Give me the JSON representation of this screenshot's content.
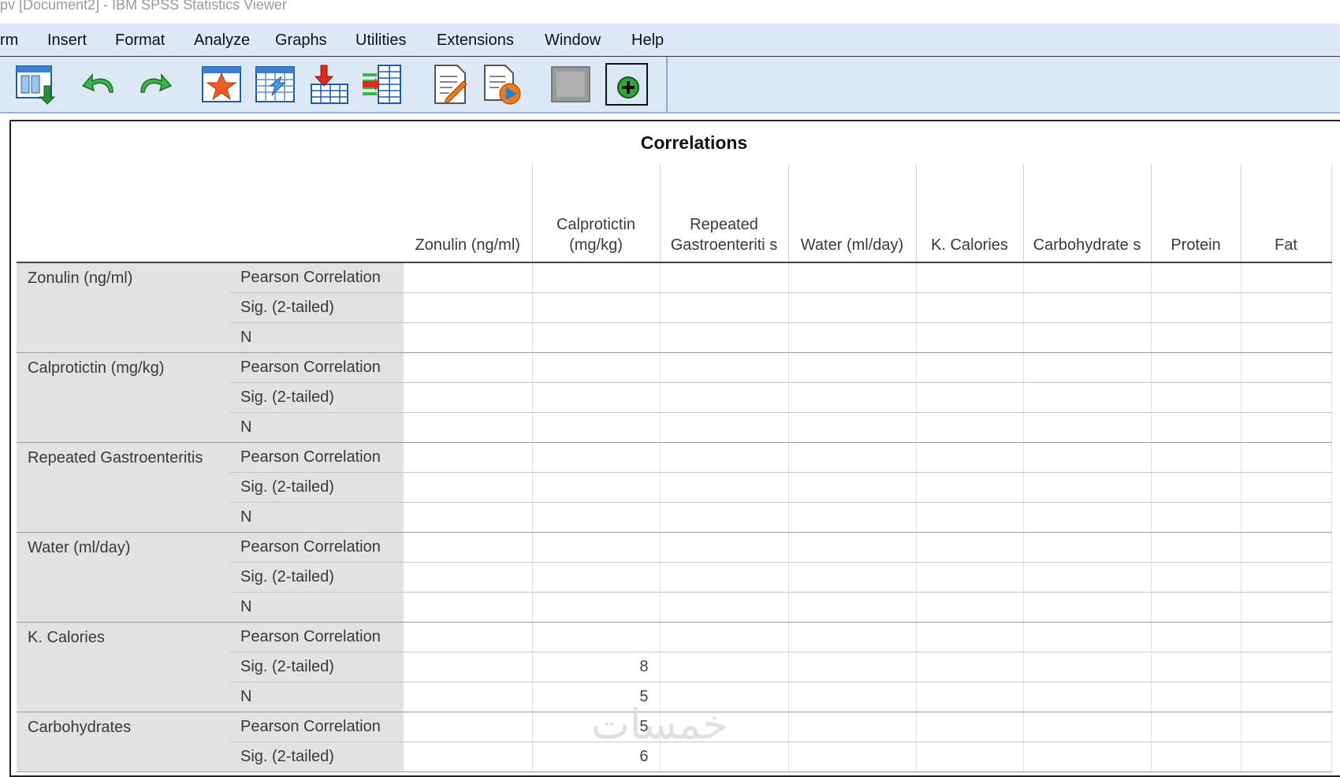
{
  "window": {
    "title": "pv [Document2] - IBM SPSS Statistics Viewer"
  },
  "menu": {
    "items": [
      {
        "label": "rm"
      },
      {
        "label": "Insert"
      },
      {
        "label": "Format"
      },
      {
        "label": "Analyze"
      },
      {
        "label": "Graphs"
      },
      {
        "label": "Utilities"
      },
      {
        "label": "Extensions"
      },
      {
        "label": "Window"
      },
      {
        "label": "Help"
      }
    ]
  },
  "toolbar": {
    "buttons": [
      {
        "icon": "export-icon"
      },
      {
        "icon": "undo-icon"
      },
      {
        "icon": "redo-icon"
      },
      {
        "icon": "goto-data-icon"
      },
      {
        "icon": "goto-case-icon"
      },
      {
        "icon": "insert-cases-icon"
      },
      {
        "icon": "insert-variable-icon"
      },
      {
        "icon": "text-output-icon"
      },
      {
        "icon": "run-script-icon"
      },
      {
        "icon": "pivot-disabled-icon"
      },
      {
        "icon": "designate-window-icon"
      }
    ]
  },
  "output": {
    "table_title": "Correlations",
    "columns": [
      "Zonulin (ng/ml)",
      "Calprotictin (mg/kg)",
      "Repeated Gastroenteriti s",
      "Water (ml/day)",
      "K. Calories",
      "Carbohydrate s",
      "Protein",
      "Fat"
    ],
    "row_groups": [
      {
        "variable": "Zonulin (ng/ml)",
        "stats": [
          "Pearson Correlation",
          "Sig. (2-tailed)",
          "N"
        ],
        "cells": [
          [
            "",
            "",
            "",
            "",
            "",
            "",
            "",
            ""
          ],
          [
            "",
            "",
            "",
            "",
            "",
            "",
            "",
            ""
          ],
          [
            "",
            "",
            "",
            "",
            "",
            "",
            "",
            ""
          ]
        ]
      },
      {
        "variable": "Calprotictin (mg/kg)",
        "stats": [
          "Pearson Correlation",
          "Sig. (2-tailed)",
          "N"
        ],
        "cells": [
          [
            "",
            "",
            "",
            "",
            "",
            "",
            "",
            ""
          ],
          [
            "",
            "",
            "",
            "",
            "",
            "",
            "",
            ""
          ],
          [
            "",
            "",
            "",
            "",
            "",
            "",
            "",
            ""
          ]
        ]
      },
      {
        "variable": "Repeated  Gastroenteritis",
        "stats": [
          "Pearson Correlation",
          "Sig. (2-tailed)",
          "N"
        ],
        "cells": [
          [
            "",
            "",
            "",
            "",
            "",
            "",
            "",
            ""
          ],
          [
            "",
            "",
            "",
            "",
            "",
            "",
            "",
            ""
          ],
          [
            "",
            "",
            "",
            "",
            "",
            "",
            "",
            ""
          ]
        ]
      },
      {
        "variable": "Water (ml/day)",
        "stats": [
          "Pearson Correlation",
          "Sig. (2-tailed)",
          "N"
        ],
        "cells": [
          [
            "",
            "",
            "",
            "",
            "",
            "",
            "",
            ""
          ],
          [
            "",
            "",
            "",
            "",
            "",
            "",
            "",
            ""
          ],
          [
            "",
            "",
            "",
            "",
            "",
            "",
            "",
            ""
          ]
        ]
      },
      {
        "variable": "K. Calories",
        "stats": [
          "Pearson Correlation",
          "Sig. (2-tailed)",
          "N"
        ],
        "cells": [
          [
            "",
            "",
            "",
            "",
            "",
            "",
            "",
            ""
          ],
          [
            "",
            "8",
            "",
            "",
            "",
            "",
            "",
            ""
          ],
          [
            "",
            "5",
            "",
            "",
            "",
            "",
            "",
            ""
          ]
        ]
      },
      {
        "variable": "Carbohydrates",
        "stats": [
          "Pearson Correlation",
          "Sig. (2-tailed)"
        ],
        "cells": [
          [
            "",
            "5",
            "",
            "",
            "",
            "",
            "",
            ""
          ],
          [
            "",
            "6",
            "",
            "",
            "",
            "",
            "",
            ""
          ]
        ]
      }
    ]
  },
  "watermark": {
    "text": "خمسات"
  }
}
